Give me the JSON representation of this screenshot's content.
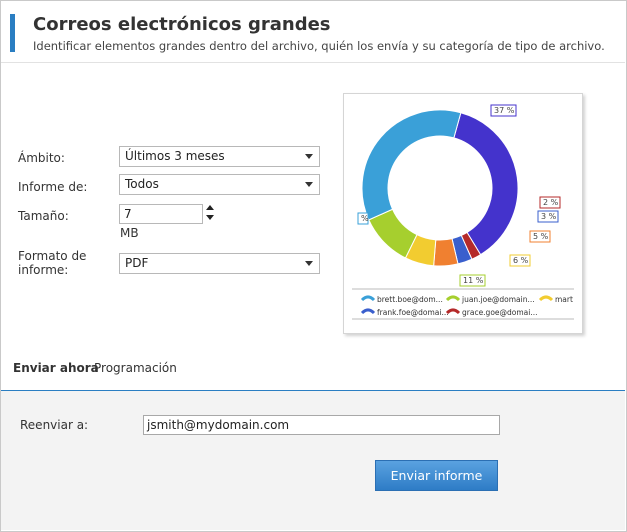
{
  "header": {
    "title": "Correos electrónicos grandes",
    "subtitle": "Identificar elementos grandes dentro del archivo, quién los envía y su categoría de tipo de archivo.",
    "accent_color": "#2a7ec2"
  },
  "form": {
    "scope": {
      "label": "Ámbito:",
      "value": "Últimos 3 meses"
    },
    "report_of": {
      "label": "Informe de:",
      "value": "Todos"
    },
    "size": {
      "label": "Tamaño:",
      "value": "7",
      "unit": "MB"
    },
    "format": {
      "label": "Formato de informe:",
      "value": "PDF"
    }
  },
  "chart_data": {
    "type": "pie",
    "style": "donut",
    "slices": [
      {
        "label": "37 %",
        "value": 37,
        "color": "#4433cc"
      },
      {
        "label": "2 %",
        "value": 2,
        "color": "#b52a2a"
      },
      {
        "label": "3 %",
        "value": 3,
        "color": "#3a5fcd"
      },
      {
        "label": "5 %",
        "value": 5,
        "color": "#f08030"
      },
      {
        "label": "6 %",
        "value": 6,
        "color": "#f2cc30"
      },
      {
        "label": "11 %",
        "value": 11,
        "color": "#a6cf2e"
      },
      {
        "label": "%",
        "value": 36,
        "color": "#3aa0d8"
      }
    ],
    "legend": [
      {
        "label": "brett.boe@dom...",
        "color": "#3aa0d8"
      },
      {
        "label": "juan.joe@domain...",
        "color": "#a6cf2e"
      },
      {
        "label": "mart",
        "color": "#f2cc30"
      },
      {
        "label": "frank.foe@domai...",
        "color": "#3a5fcd"
      },
      {
        "label": "grace.goe@domai...",
        "color": "#b52a2a"
      }
    ]
  },
  "tabs": [
    {
      "label": "Enviar ahora",
      "active": true
    },
    {
      "label": "Programación",
      "active": false
    }
  ],
  "forward": {
    "label": "Reenviar a:",
    "value": "jsmith@mydomain.com"
  },
  "send_button": {
    "label": "Enviar informe"
  }
}
